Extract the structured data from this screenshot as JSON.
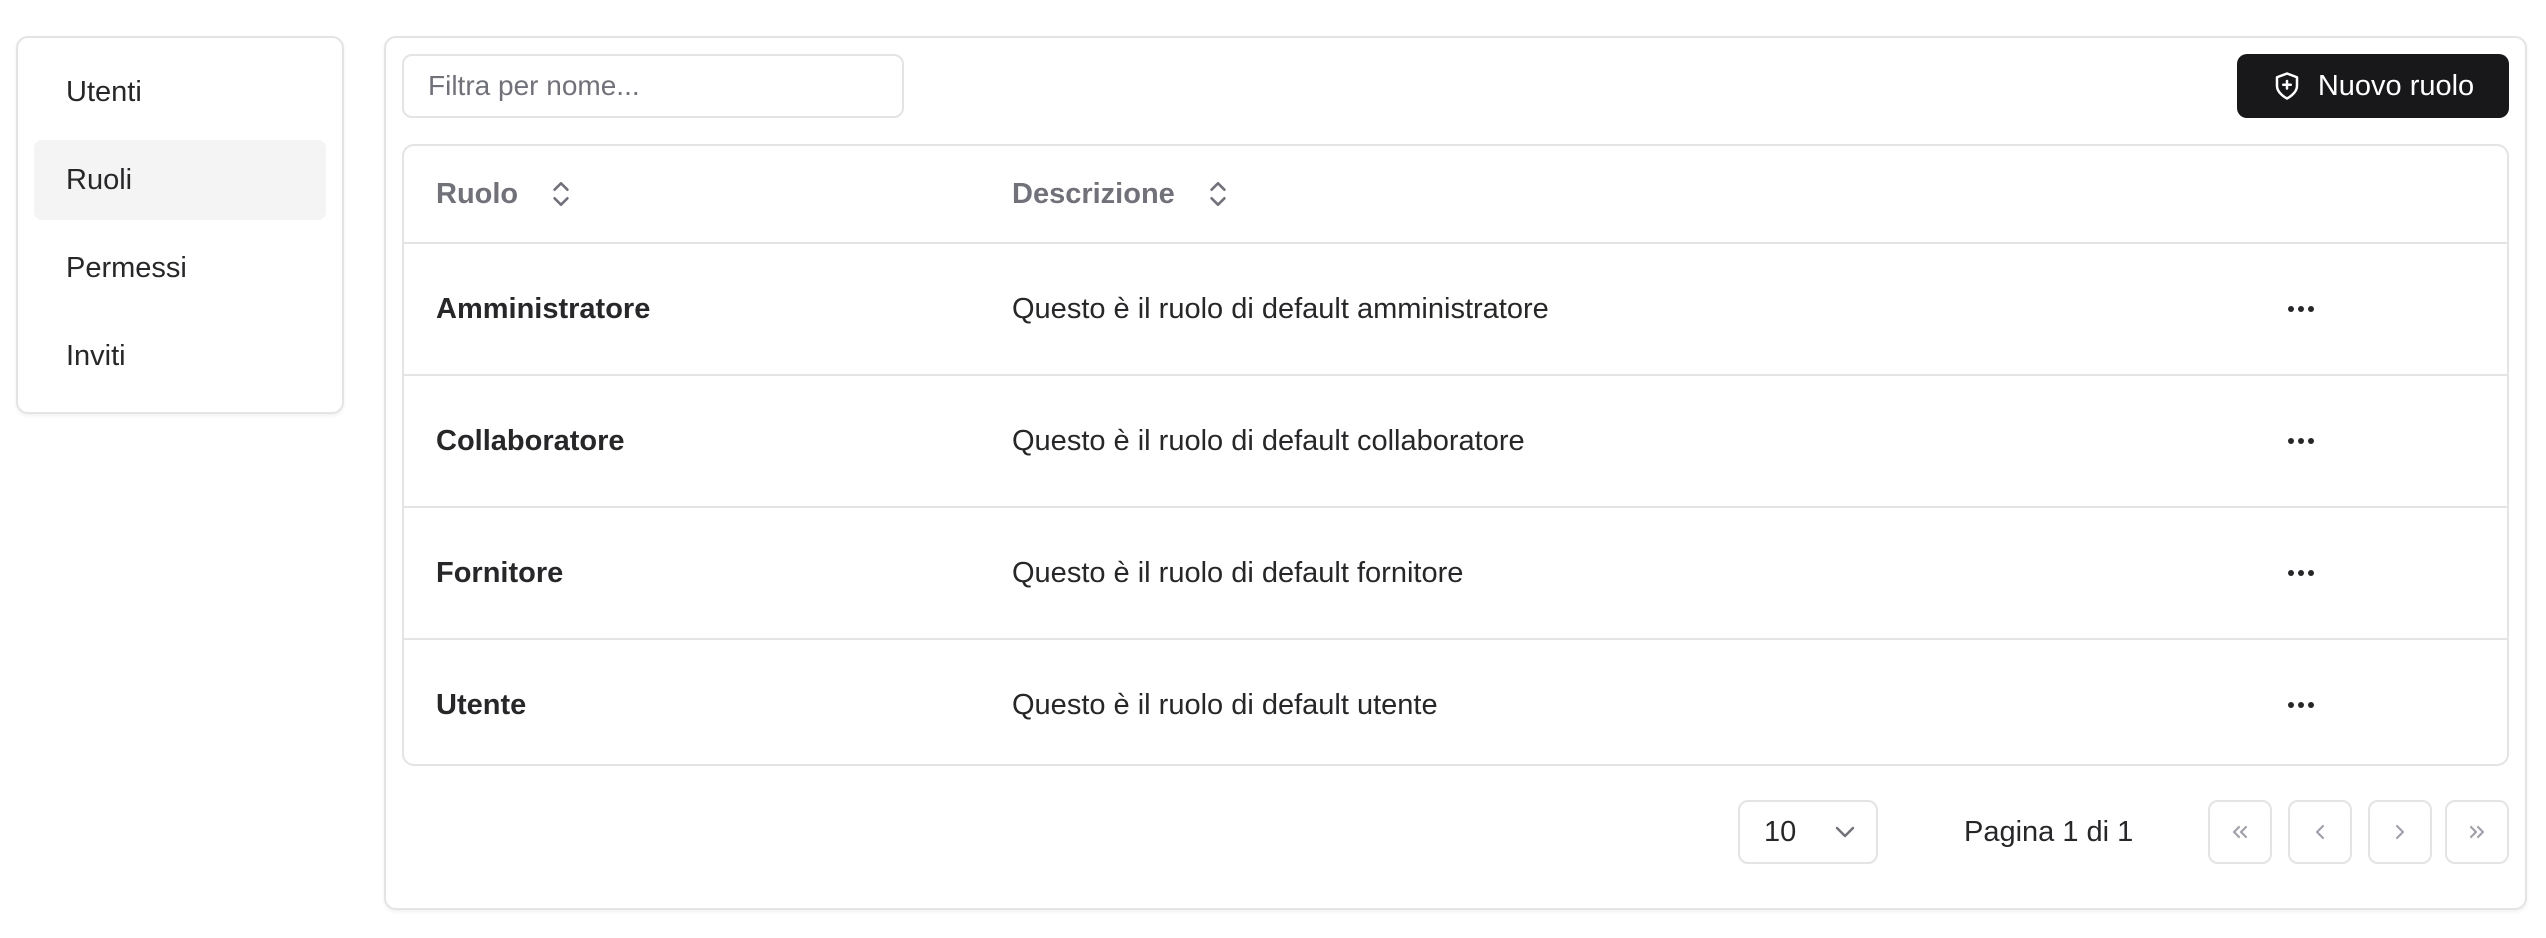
{
  "sidebar": {
    "items": [
      {
        "label": "Utenti",
        "active": false
      },
      {
        "label": "Ruoli",
        "active": true
      },
      {
        "label": "Permessi",
        "active": false
      },
      {
        "label": "Inviti",
        "active": false
      }
    ]
  },
  "toolbar": {
    "filter_placeholder": "Filtra per nome...",
    "filter_value": "",
    "new_button_label": "Nuovo ruolo",
    "new_button_icon": "shield-plus-icon"
  },
  "table": {
    "columns": [
      {
        "label": "Ruolo",
        "sort_icon": "sort-icon"
      },
      {
        "label": "Descrizione",
        "sort_icon": "sort-icon"
      }
    ],
    "rows": [
      {
        "role": "Amministratore",
        "description": "Questo è il ruolo di default amministratore"
      },
      {
        "role": "Collaboratore",
        "description": "Questo è il ruolo di default collaboratore"
      },
      {
        "role": "Fornitore",
        "description": "Questo è il ruolo di default fornitore"
      },
      {
        "role": "Utente",
        "description": "Questo è il ruolo di default utente"
      }
    ]
  },
  "pagination": {
    "page_size": "10",
    "page_info": "Pagina 1 di 1"
  },
  "colors": {
    "primary_button": "#18181b",
    "border": "#e4e4e7",
    "active_item_bg": "#f4f4f5",
    "muted_text": "#71717a"
  }
}
